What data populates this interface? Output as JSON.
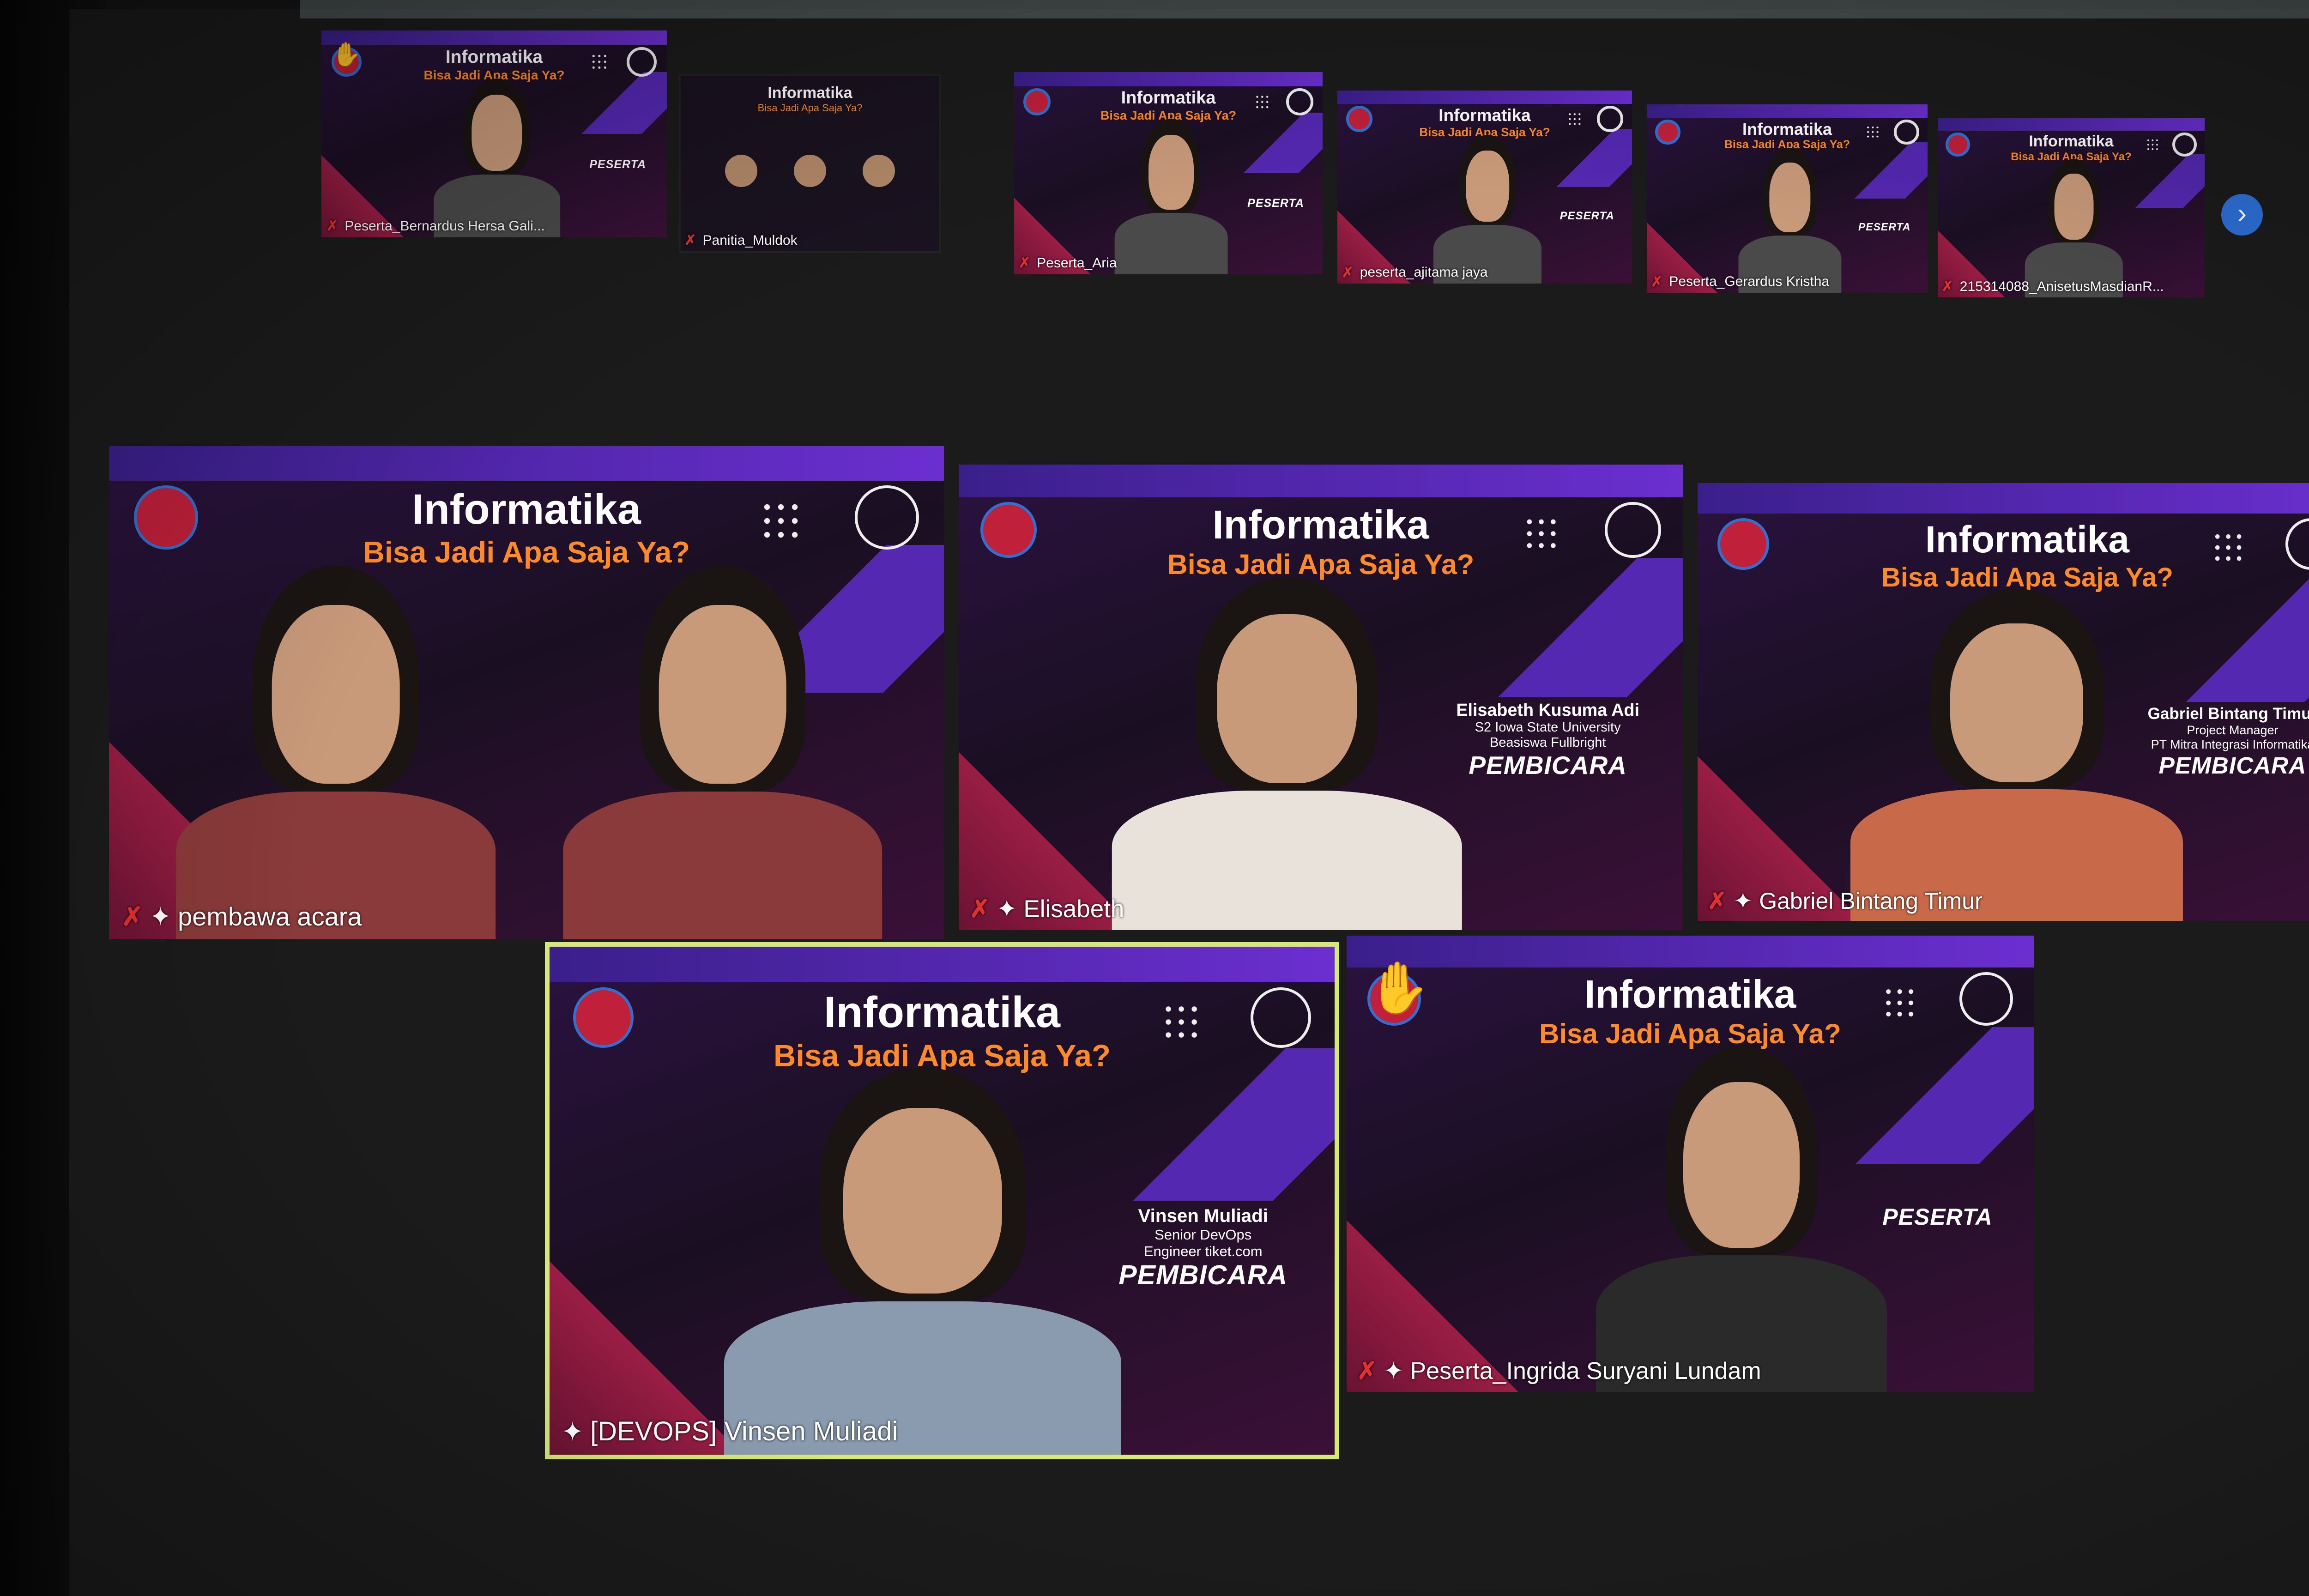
{
  "theme": {
    "accent_purple": "#6b2fd0",
    "accent_orange": "#ff8a2a",
    "active_border": "#d6e87a",
    "mic_muted": "#e03030",
    "background": "#1b1b1b"
  },
  "event": {
    "title": "Informatika",
    "subtitle": "Bisa Jadi Apa Saja Ya?"
  },
  "top_row": [
    {
      "name": "Peserta_Bernardus Hersa Gali...",
      "mic": "muted",
      "hand_raised": true,
      "role_badge": "PESERTA"
    },
    {
      "name": "Panitia_Muldok",
      "mic": "muted",
      "hand_raised": false,
      "is_slide": true
    },
    {
      "name": "Peserta_Aria",
      "mic": "muted",
      "hand_raised": false,
      "role_badge": "PESERTA"
    },
    {
      "name": "peserta_ajitama jaya",
      "mic": "muted",
      "hand_raised": false,
      "role_badge": "PESERTA"
    },
    {
      "name": "Peserta_Gerardus Kristha",
      "mic": "muted",
      "hand_raised": false,
      "role_badge": "PESERTA"
    },
    {
      "name": "215314088_AnisetusMasdianR...",
      "mic": "muted",
      "hand_raised": false
    }
  ],
  "main_row": [
    {
      "name": "pembawa acara",
      "mic": "muted",
      "pinned": true
    },
    {
      "name": "Elisabeth",
      "mic": "muted",
      "pinned": true,
      "speaker_name": "Elisabeth Kusuma Adi",
      "speaker_line1": "S2 Iowa State University",
      "speaker_line2": "Beasiswa Fullbright",
      "role": "PEMBICARA"
    },
    {
      "name": "Gabriel Bintang Timur",
      "mic": "muted",
      "pinned": true,
      "speaker_name": "Gabriel Bintang Timur",
      "speaker_line1": "Project Manager",
      "speaker_line2": "PT Mitra Integrasi Informatika",
      "role": "PEMBICARA"
    }
  ],
  "bottom_row": [
    {
      "name": "[DEVOPS] Vinsen Muliadi",
      "pinned": true,
      "active_speaker": true,
      "speaker_name": "Vinsen Muliadi",
      "speaker_line1": "Senior DevOps",
      "speaker_line2": "Engineer tiket.com",
      "role": "PEMBICARA"
    },
    {
      "name": "Peserta_Ingrida Suryani Lundam",
      "mic": "muted",
      "pinned": true,
      "hand_raised": true,
      "role": "PESERTA"
    }
  ],
  "icons": {
    "mic_muted": "mic-muted-icon",
    "pin": "pin-icon",
    "hand": "raised-hand-icon",
    "next_page": "chevron-right-icon"
  },
  "next_page_glyph": "›",
  "mic_glyph": "✗",
  "pin_glyph": "✦",
  "hand_glyph": "✋"
}
